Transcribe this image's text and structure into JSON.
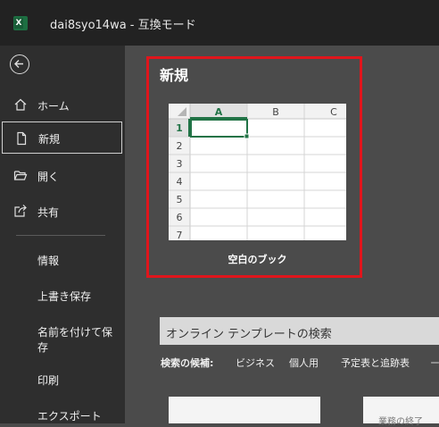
{
  "window": {
    "app_icon": "excel-icon",
    "app_icon_letter": "X",
    "title": "dai8syo14wa  -  互換モード"
  },
  "sidebar": {
    "back_icon": "back-arrow-icon",
    "items": [
      {
        "label": "ホーム",
        "icon": "home-icon"
      },
      {
        "label": "新規",
        "icon": "new-document-icon",
        "selected": true
      },
      {
        "label": "開く",
        "icon": "open-folder-icon"
      },
      {
        "label": "共有",
        "icon": "share-icon"
      }
    ],
    "subitems": [
      {
        "label": "情報"
      },
      {
        "label": "上書き保存"
      },
      {
        "label": "名前を付けて保存"
      },
      {
        "label": "印刷"
      },
      {
        "label": "エクスポート"
      }
    ]
  },
  "main": {
    "heading": "新規",
    "blank_workbook": {
      "label": "空白のブック",
      "columns": [
        "A",
        "B",
        "C"
      ],
      "rows": [
        "1",
        "2",
        "3",
        "4",
        "5",
        "6",
        "7"
      ]
    },
    "search": {
      "placeholder": "オンライン テンプレートの検索"
    },
    "suggestions": {
      "label": "検索の候補:",
      "items": [
        "ビジネス",
        "個人用",
        "予定表と追跡表"
      ],
      "more": "ー"
    },
    "template_card_text": "業務の終了"
  },
  "colors": {
    "highlight_border": "#e0151c",
    "title_bar": "#222222",
    "sidebar": "#2e2e2e",
    "main": "#4b4b4b",
    "excel_green": "#1d6f42"
  }
}
